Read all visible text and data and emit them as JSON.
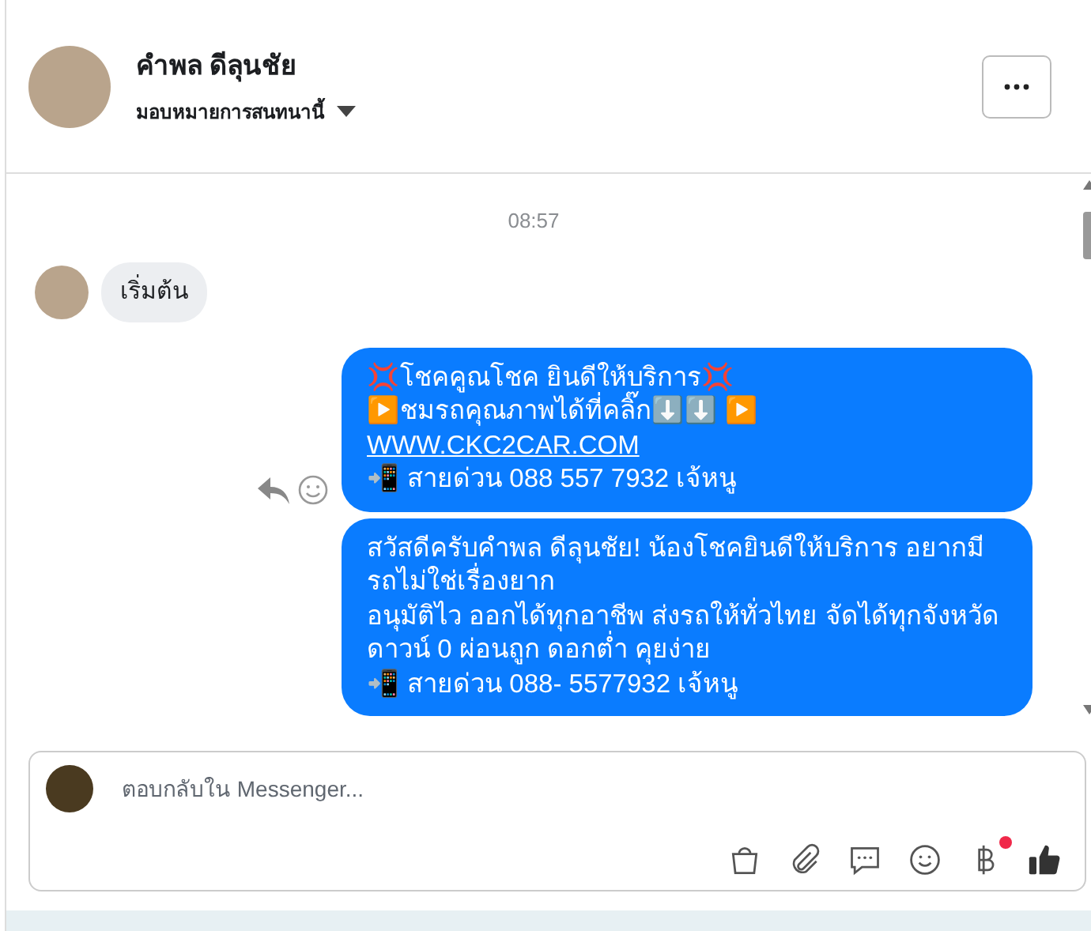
{
  "header": {
    "name": "คำพล ดีลุนชัย",
    "assign_label": "มอบหมายการสนทนานี้"
  },
  "messages": [
    {
      "kind": "timestamp",
      "text": "08:57"
    },
    {
      "kind": "incoming",
      "lines": [
        "เริ่มต้น"
      ]
    },
    {
      "kind": "outgoing",
      "show_actions": true,
      "lines": [
        "💢โชคคูณโชค ยินดีให้บริการ💢",
        "▶️ชมรถคุณภาพได้ที่คลิ๊ก⬇️⬇️      ▶️"
      ],
      "link": "WWW.CKC2CAR.COM",
      "after_link": [
        "📲 สายด่วน 088 557 7932 เจ้หนู"
      ]
    },
    {
      "kind": "outgoing",
      "show_actions": false,
      "lines": [
        "สวัสดีครับคำพล ดีลุนชัย! น้องโชคยินดีให้บริการ อยากมีรถไม่ใช่เรื่องยาก",
        "อนุมัติไว ออกได้ทุกอาชีพ ส่งรถให้ทั่วไทย จัดได้ทุกจังหวัด ดาวน์ 0  ผ่อนถูก ดอกต่ำ คุยง่าย",
        "📲 สายด่วน 088- 5577932 เจ้หนู"
      ]
    }
  ],
  "composer": {
    "placeholder": "ตอบกลับใน Messenger...",
    "payment_notification": true
  }
}
